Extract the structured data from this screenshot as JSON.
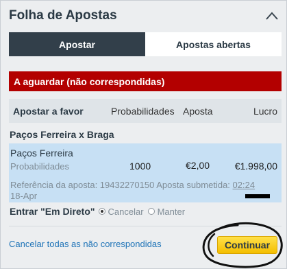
{
  "header": {
    "title": "Folha de Apostas",
    "collapse_icon": "chevron-up-icon"
  },
  "tabs": [
    {
      "label": "Apostar",
      "active": true
    },
    {
      "label": "Apostas abertas",
      "active": false
    }
  ],
  "status_banner": "A aguardar (não correspondidas)",
  "columns": {
    "favor": "Apostar a favor",
    "odds": "Probabilidades",
    "stake": "Aposta",
    "profit": "Lucro"
  },
  "match": "Paços Ferreira x Braga",
  "bet": {
    "selection": "Paços Ferreira",
    "odds_label": "Probabilidades",
    "odds": "1000",
    "stake": "€2,00",
    "profit": "€1.998,00",
    "reference_text": "Referência da aposta: 19432270150 Aposta submetida:",
    "submitted_time": "02:24",
    "submitted_date": "18-Apr"
  },
  "inplay": {
    "label": "Entrar \"Em Direto\"",
    "options": [
      {
        "label": "Cancelar",
        "checked": true
      },
      {
        "label": "Manter",
        "checked": false
      }
    ]
  },
  "footer": {
    "cancel_all": "Cancelar todas as não correspondidas",
    "continue": "Continuar"
  },
  "colors": {
    "status_red": "#b30000",
    "active_tab": "#323f4a",
    "bet_box": "#c7e0f4",
    "link_blue": "#1e73b7",
    "button_yellow": "#f4be00"
  }
}
